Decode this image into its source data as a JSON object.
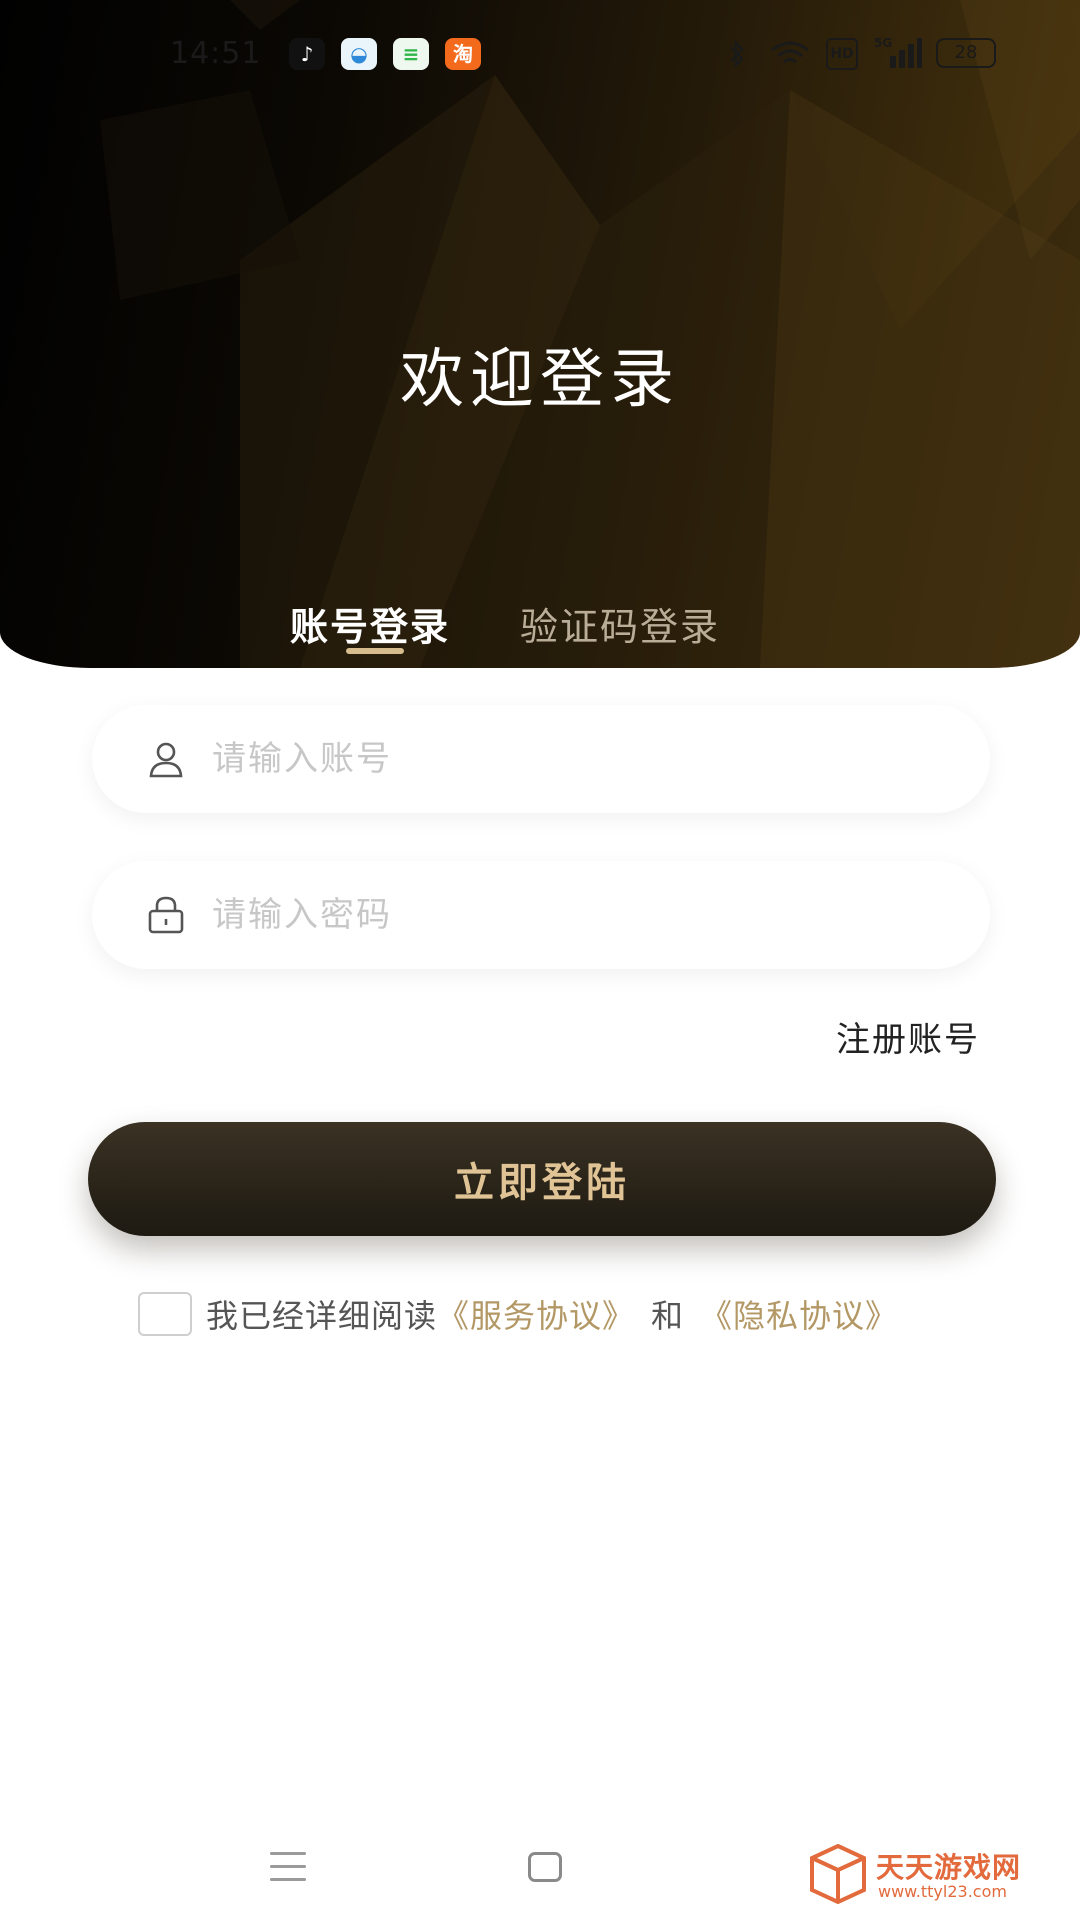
{
  "status_bar": {
    "time": "14:51",
    "apps": [
      {
        "icon": "tiktok-icon",
        "glyph": "♪"
      },
      {
        "icon": "browser-icon",
        "glyph": "◒"
      },
      {
        "icon": "chat-icon",
        "glyph": "≡"
      },
      {
        "icon": "taobao-icon",
        "glyph": "淘"
      }
    ],
    "network": "5G",
    "hd": "HD",
    "battery": "28"
  },
  "header": {
    "title": "欢迎登录",
    "tabs": [
      {
        "label": "账号登录",
        "active": true
      },
      {
        "label": "验证码登录",
        "active": false
      }
    ]
  },
  "form": {
    "account_placeholder": "请输入账号",
    "account_value": "",
    "password_placeholder": "请输入密码",
    "password_value": "",
    "register_label": "注册账号",
    "login_label": "立即登陆"
  },
  "agreement": {
    "checked": false,
    "prefix": "我已经详细阅读",
    "service_link": "《服务协议》",
    "conjunction": "和",
    "privacy_link": "《隐私协议》"
  },
  "watermark": {
    "title": "天天游戏网",
    "url": "www.ttyl23.com"
  },
  "colors": {
    "accent_gold": "#d7bc8d",
    "button_text": "#e0c495",
    "link": "#b39866",
    "header_dark": "#0c0904"
  }
}
